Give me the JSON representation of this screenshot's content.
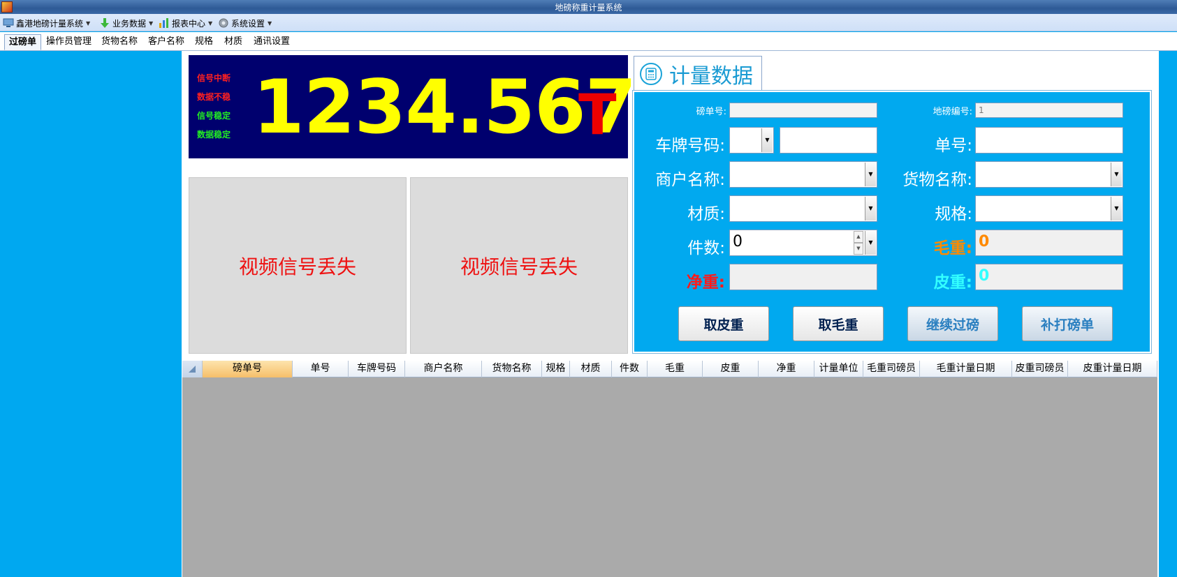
{
  "window": {
    "title": "地磅称重计量系统"
  },
  "menu": [
    {
      "label": "鑫港地磅计量系统",
      "icon": "monitor-icon"
    },
    {
      "label": "业务数据",
      "icon": "download-arrow-icon"
    },
    {
      "label": "报表中心",
      "icon": "bar-chart-icon"
    },
    {
      "label": "系统设置",
      "icon": "gear-icon"
    }
  ],
  "tabs": [
    "过磅单",
    "操作员管理",
    "货物名称",
    "客户名称",
    "规格",
    "材质",
    "通讯设置"
  ],
  "active_tab": "过磅单",
  "scale": {
    "status": [
      {
        "text": "信号中断",
        "color": "#ff2020"
      },
      {
        "text": "数据不稳",
        "color": "#ff2020"
      },
      {
        "text": "信号稳定",
        "color": "#22ee22"
      },
      {
        "text": "数据稳定",
        "color": "#22ee22"
      }
    ],
    "weight": "1234.567",
    "unit": "T"
  },
  "video": {
    "left_text": "视频信号丢失",
    "right_text": "视频信号丢失"
  },
  "panel": {
    "title": "计量数据"
  },
  "form": {
    "ticket_no_label": "磅单号:",
    "ticket_no_value": "",
    "scale_no_label": "地磅编号:",
    "scale_no_value": "1",
    "plate_label": "车牌号码:",
    "plate_prefix": "",
    "plate_value": "",
    "order_no_label": "单号:",
    "order_no_value": "",
    "merchant_label": "商户名称:",
    "merchant_value": "",
    "goods_label": "货物名称:",
    "goods_value": "",
    "material_label": "材质:",
    "material_value": "",
    "spec_label": "规格:",
    "spec_value": "",
    "pieces_label": "件数:",
    "pieces_value": "0",
    "gross_label": "毛重:",
    "gross_value": "0",
    "net_label": "净重:",
    "net_value": "",
    "tare_label": "皮重:",
    "tare_value": "0",
    "colors": {
      "gross": "#ff8a00",
      "net": "#ff1a1a",
      "tare": "#33ffff"
    }
  },
  "buttons": {
    "take_tare": "取皮重",
    "take_gross": "取毛重",
    "continue": "继续过磅",
    "reprint": "补打磅单"
  },
  "grid": {
    "columns": [
      "磅单号",
      "单号",
      "车牌号码",
      "商户名称",
      "货物名称",
      "规格",
      "材质",
      "件数",
      "毛重",
      "皮重",
      "净重",
      "计量单位",
      "毛重司磅员",
      "毛重计量日期",
      "皮重司磅员",
      "皮重计量日期"
    ]
  }
}
